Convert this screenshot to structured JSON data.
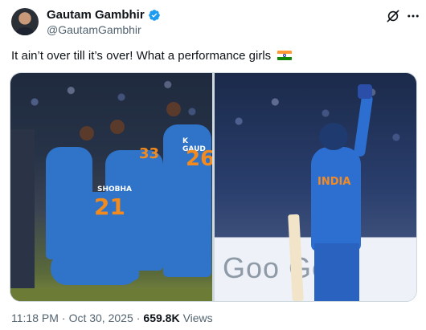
{
  "tweet": {
    "display_name": "Gautam Gambhir",
    "handle": "@GautamGambhir",
    "text": "It ain’t over till it’s over! What a performance girls",
    "flag_emoji": "india-flag",
    "time": "11:18 PM",
    "separator": "·",
    "date": "Oct 30, 2025",
    "separator2": "·",
    "views_count": "659.8K",
    "views_label": "Views"
  },
  "media": {
    "left_photo": {
      "jersey_numbers": [
        "33",
        "26",
        "21"
      ],
      "jersey_names": [
        "K GAUD",
        "SHOBHA"
      ]
    },
    "right_photo": {
      "jersey_text": "INDIA",
      "hoarding_text": "Goo  Ge"
    }
  },
  "icons": [
    "verified-icon",
    "grok-icon",
    "more-icon"
  ],
  "colors": {
    "text_primary": "#0f1419",
    "text_secondary": "#536471",
    "verified_blue": "#1d9bf0",
    "border": "#cfd9de",
    "jersey_blue": "#2f74c8",
    "jersey_orange": "#f28a1e"
  }
}
